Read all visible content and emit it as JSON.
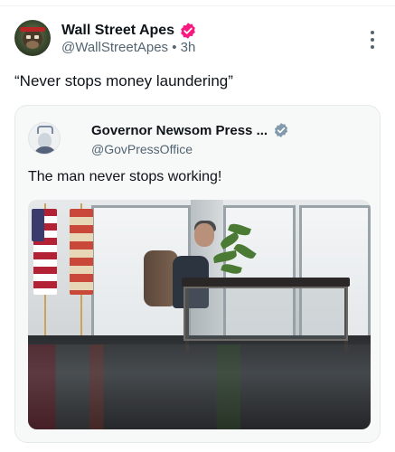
{
  "post": {
    "author": {
      "display_name": "Wall Street Apes",
      "handle": "@WallStreetApes",
      "separator": "•",
      "time": "3h",
      "avatar_icon": "ape-avatar-icon",
      "verified_badge_color": "#f91880"
    },
    "text": "“Never stops money laundering”",
    "quote": {
      "author": {
        "display_name": "Governor Newsom Press ...",
        "handle": "@GovPressOffice",
        "verified_badge_color": "#829aab"
      },
      "text": "The man never stops working!"
    }
  },
  "colors": {
    "text_primary": "#0f1419",
    "text_secondary": "#536471",
    "card_background": "#f7f9f9"
  }
}
